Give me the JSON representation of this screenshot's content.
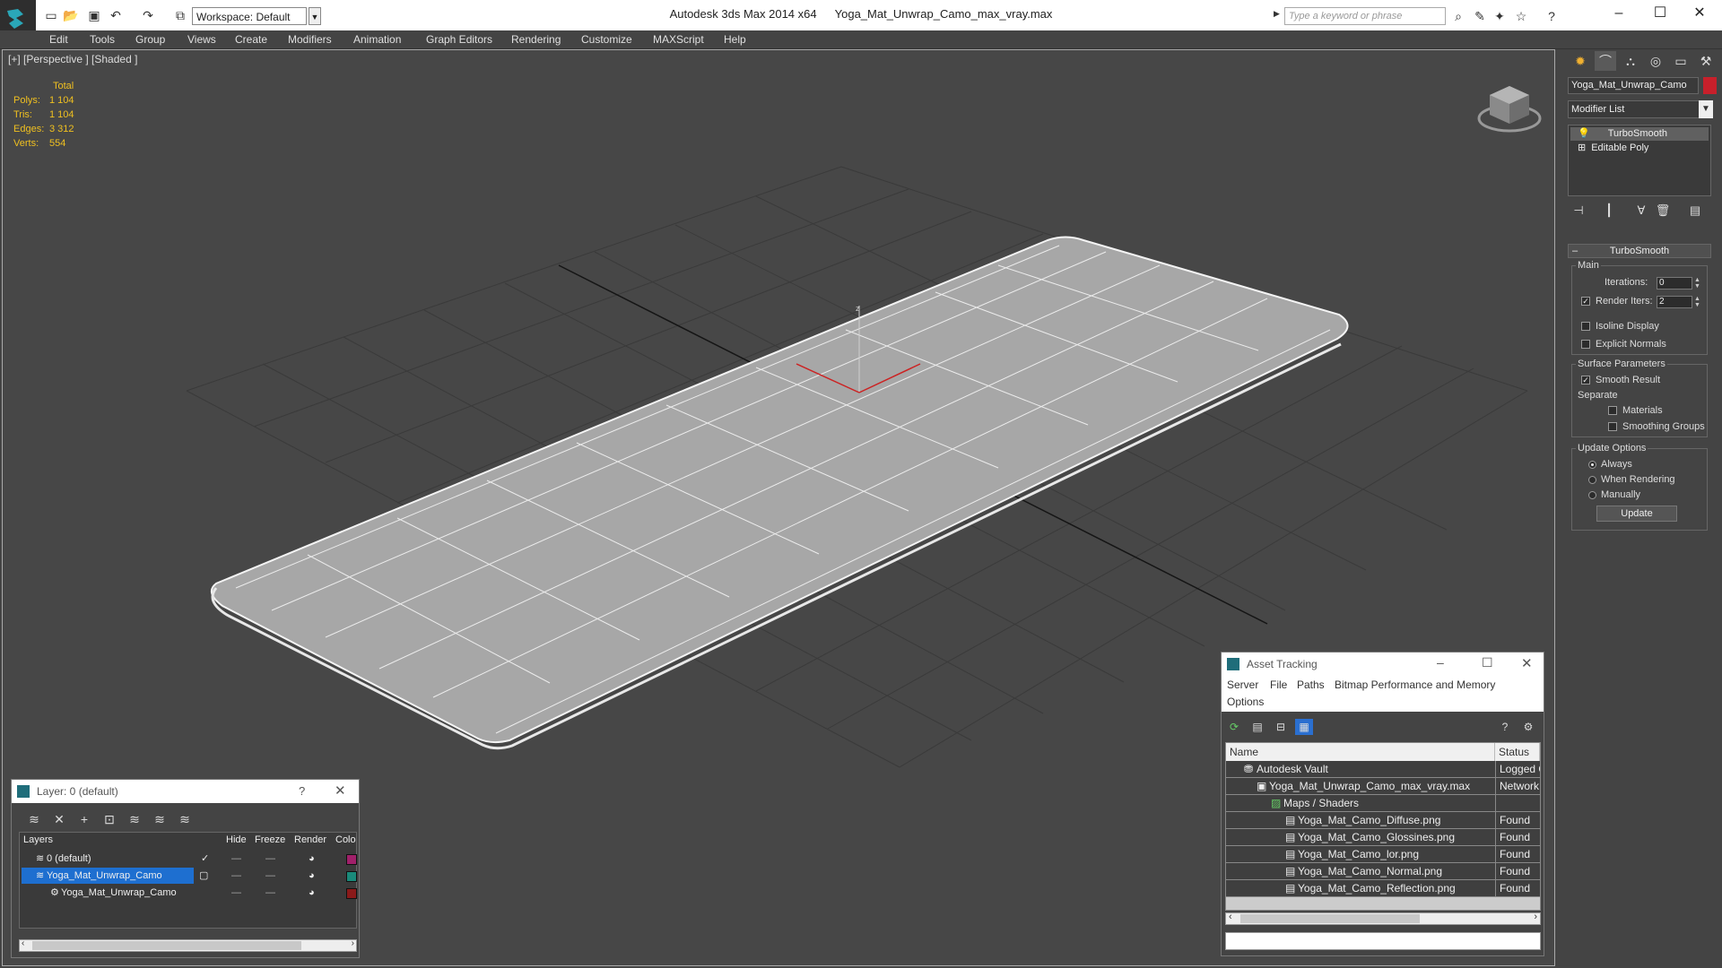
{
  "window": {
    "app_name": "Autodesk 3ds Max  2014 x64",
    "file_name": "Yoga_Mat_Unwrap_Camo_max_vray.max",
    "workspace": "Workspace: Default",
    "search_placeholder": "Type a keyword or phrase"
  },
  "menu": [
    "Edit",
    "Tools",
    "Group",
    "Views",
    "Create",
    "Modifiers",
    "Animation",
    "Graph Editors",
    "Rendering",
    "Customize",
    "MAXScript",
    "Help"
  ],
  "viewport": {
    "label": "[+] [Perspective ] [Shaded ]",
    "stats_header": "Total",
    "stats": [
      {
        "label": "Polys:",
        "value": "1 104"
      },
      {
        "label": "Tris:",
        "value": "1 104"
      },
      {
        "label": "Edges:",
        "value": "3 312"
      },
      {
        "label": "Verts:",
        "value": "554"
      }
    ],
    "axis_label": "z"
  },
  "command_panel": {
    "object_name": "Yoga_Mat_Unwrap_Camo",
    "object_color": "#c8202b",
    "modifier_list": "Modifier List",
    "stack": [
      "TurboSmooth",
      "Editable Poly"
    ],
    "rollout_title": "TurboSmooth",
    "main": {
      "title": "Main",
      "iterations_label": "Iterations:",
      "iterations": "0",
      "render_iters_label": "Render Iters:",
      "render_iters": "2",
      "isoline": "Isoline Display",
      "explicit": "Explicit Normals"
    },
    "surface": {
      "title": "Surface Parameters",
      "smooth": "Smooth Result",
      "separate": "Separate",
      "materials": "Materials",
      "smoothing_groups": "Smoothing Groups"
    },
    "update_options": {
      "title": "Update Options",
      "always": "Always",
      "when_rendering": "When Rendering",
      "manually": "Manually",
      "button": "Update"
    }
  },
  "layer_dialog": {
    "title": "Layer: 0 (default)",
    "help": "?",
    "columns": [
      "Layers",
      "Hide",
      "Freeze",
      "Render",
      "Colo"
    ],
    "rows": [
      {
        "name": "0 (default)",
        "color": "#a0206a"
      },
      {
        "name": "Yoga_Mat_Unwrap_Camo",
        "color": "#1a8a7a"
      },
      {
        "name": "Yoga_Mat_Unwrap_Camo",
        "color": "#8a1a1a"
      }
    ]
  },
  "asset_dialog": {
    "title": "Asset Tracking",
    "menu": [
      "Server",
      "File",
      "Paths",
      "Bitmap Performance and Memory",
      "Options"
    ],
    "columns": [
      "Name",
      "Status"
    ],
    "rows": [
      {
        "name": "Autodesk Vault",
        "status": "Logged O"
      },
      {
        "name": "Yoga_Mat_Unwrap_Camo_max_vray.max",
        "status": "Network I"
      },
      {
        "name": "Maps / Shaders",
        "status": ""
      },
      {
        "name": "Yoga_Mat_Camo_Diffuse.png",
        "status": "Found"
      },
      {
        "name": "Yoga_Mat_Camo_Glossines.png",
        "status": "Found"
      },
      {
        "name": "Yoga_Mat_Camo_lor.png",
        "status": "Found"
      },
      {
        "name": "Yoga_Mat_Camo_Normal.png",
        "status": "Found"
      },
      {
        "name": "Yoga_Mat_Camo_Reflection.png",
        "status": "Found"
      }
    ]
  }
}
